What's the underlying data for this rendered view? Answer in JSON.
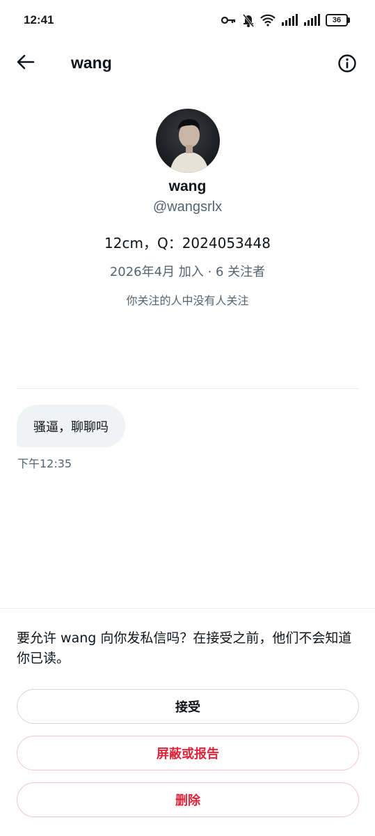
{
  "status_bar": {
    "time": "12:41",
    "battery": "36"
  },
  "header": {
    "title": "wang",
    "back_icon": "arrow-left-icon",
    "info_icon": "info-circle-icon"
  },
  "profile": {
    "name": "wang",
    "handle": "@wangsrlx",
    "bio": "12cm，Q：2024053448",
    "meta": "2026年4月 加入 · 6 关注者",
    "followers_note": "你关注的人中没有人关注"
  },
  "conversation": {
    "messages": [
      {
        "text": "骚逼，聊聊吗",
        "time": "下午12:35"
      }
    ]
  },
  "request_panel": {
    "prompt": "要允许 wang 向你发私信吗？在接受之前，他们不会知道你已读。",
    "accept_label": "接受",
    "block_label": "屏蔽或报告",
    "delete_label": "删除"
  },
  "colors": {
    "text_primary": "#0f1419",
    "text_secondary": "#536471",
    "danger": "#e0243a",
    "bubble_bg": "#eff3f4"
  }
}
